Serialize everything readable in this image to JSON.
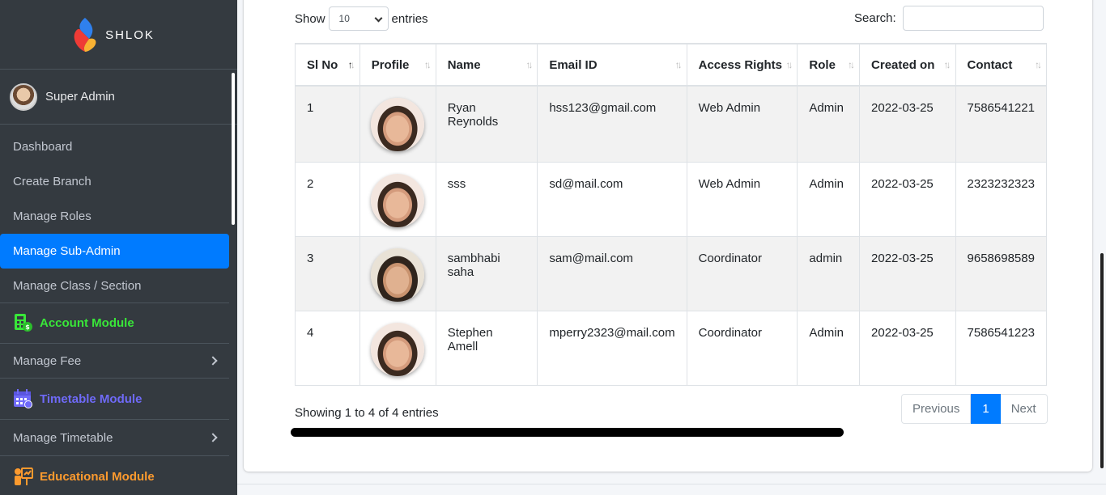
{
  "brand": {
    "name": "SHLOK"
  },
  "user": {
    "name": "Super Admin"
  },
  "sidebar": {
    "items": [
      {
        "label": "Dashboard"
      },
      {
        "label": "Create Branch"
      },
      {
        "label": "Manage Roles"
      },
      {
        "label": "Manage Sub-Admin",
        "active": true
      },
      {
        "label": "Manage Class / Section"
      }
    ],
    "modules": [
      {
        "label": "Account Module",
        "color": "#39e639"
      },
      {
        "label": "Timetable Module",
        "color": "#6f6af8"
      },
      {
        "label": "Educational Module",
        "color": "#fd9a2e"
      }
    ],
    "submenus": [
      {
        "label": "Manage Fee"
      },
      {
        "label": "Manage Timetable"
      }
    ]
  },
  "table_controls": {
    "show_label": "Show",
    "entries_value": "10",
    "entries_label": "entries",
    "search_label": "Search:"
  },
  "table": {
    "columns": [
      "Sl No",
      "Profile",
      "Name",
      "Email ID",
      "Access Rights",
      "Role",
      "Created on",
      "Contact"
    ],
    "rows": [
      {
        "sl": "1",
        "name": "Ryan Reynolds",
        "email": "hss123@gmail.com",
        "access": "Web Admin",
        "role": "Admin",
        "created": "2022-03-25",
        "contact": "7586541221"
      },
      {
        "sl": "2",
        "name": "sss",
        "email": "sd@mail.com",
        "access": "Web Admin",
        "role": "Admin",
        "created": "2022-03-25",
        "contact": "2323232323"
      },
      {
        "sl": "3",
        "name": "sambhabi saha",
        "email": "sam@mail.com",
        "access": "Coordinator",
        "role": "admin",
        "created": "2022-03-25",
        "contact": "9658698589"
      },
      {
        "sl": "4",
        "name": "Stephen Amell",
        "email": "mperry2323@mail.com",
        "access": "Coordinator",
        "role": "Admin",
        "created": "2022-03-25",
        "contact": "7586541223"
      }
    ]
  },
  "footer": {
    "showing": "Showing 1 to 4 of 4 entries",
    "previous": "Previous",
    "current_page": "1",
    "next": "Next"
  },
  "colors": {
    "primary": "#007bff",
    "sidebar": "#343a40"
  }
}
